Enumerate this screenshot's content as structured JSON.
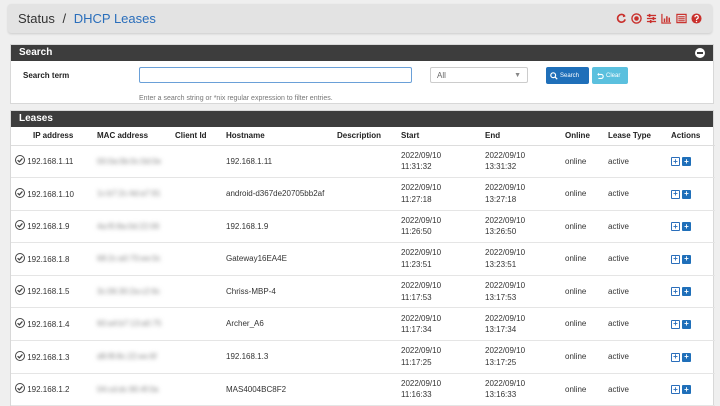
{
  "header": {
    "breadcrumb_root": "Status",
    "breadcrumb_sep": "/",
    "breadcrumb_page": "DHCP Leases",
    "icon_color": "#c9302c",
    "icons": [
      "reload-icon",
      "record-icon",
      "settings-sliders-icon",
      "chart-icon",
      "log-icon",
      "help-icon"
    ]
  },
  "search": {
    "title": "Search",
    "term_label": "Search term",
    "term_value": "",
    "filter_selected": "All",
    "search_button": "Search",
    "clear_button": "Clear",
    "help_text": "Enter a search string or *nix regular expression to filter entries."
  },
  "leases": {
    "title": "Leases",
    "columns": [
      "IP address",
      "MAC address",
      "Client Id",
      "Hostname",
      "Description",
      "Start",
      "End",
      "Online",
      "Lease Type",
      "Actions"
    ],
    "rows": [
      {
        "ip": "192.168.1.11",
        "mac": "00:0a:0b:0c:0d:0e",
        "client_id": "",
        "hostname": "192.168.1.11",
        "description": "",
        "start_date": "2022/09/10",
        "start_time": "11:31:32",
        "end_date": "2022/09/10",
        "end_time": "13:31:32",
        "online": "online",
        "lease_type": "active"
      },
      {
        "ip": "192.168.1.10",
        "mac": "1c:b7:2c:4d:a7:91",
        "client_id": "",
        "hostname": "android-d367de20705bb2af",
        "description": "",
        "start_date": "2022/09/10",
        "start_time": "11:27:18",
        "end_date": "2022/09/10",
        "end_time": "13:27:18",
        "online": "online",
        "lease_type": "active"
      },
      {
        "ip": "192.168.1.9",
        "mac": "4a:f0:8a:0d:22:06",
        "client_id": "",
        "hostname": "192.168.1.9",
        "description": "",
        "start_date": "2022/09/10",
        "start_time": "11:26:50",
        "end_date": "2022/09/10",
        "end_time": "13:26:50",
        "online": "online",
        "lease_type": "active"
      },
      {
        "ip": "192.168.1.8",
        "mac": "68:2c:a0:70:ee:0c",
        "client_id": "",
        "hostname": "Gateway16EA4E",
        "description": "",
        "start_date": "2022/09/10",
        "start_time": "11:23:51",
        "end_date": "2022/09/10",
        "end_time": "13:23:51",
        "online": "online",
        "lease_type": "active"
      },
      {
        "ip": "192.168.1.5",
        "mac": "3c:06:30:2a:c2:6c",
        "client_id": "",
        "hostname": "Chriss-MBP-4",
        "description": "",
        "start_date": "2022/09/10",
        "start_time": "11:17:53",
        "end_date": "2022/09/10",
        "end_time": "13:17:53",
        "online": "online",
        "lease_type": "active"
      },
      {
        "ip": "192.168.1.4",
        "mac": "60:a4:b7:13:a0:75",
        "client_id": "",
        "hostname": "Archer_A6",
        "description": "",
        "start_date": "2022/09/10",
        "start_time": "11:17:34",
        "end_date": "2022/09/10",
        "end_time": "13:17:34",
        "online": "online",
        "lease_type": "active"
      },
      {
        "ip": "192.168.1.3",
        "mac": "d8:f8:8c:22:ee:6f",
        "client_id": "",
        "hostname": "192.168.1.3",
        "description": "",
        "start_date": "2022/09/10",
        "start_time": "11:17:25",
        "end_date": "2022/09/10",
        "end_time": "13:17:25",
        "online": "online",
        "lease_type": "active"
      },
      {
        "ip": "192.168.1.2",
        "mac": "04:cd:dc:90:4f:0a",
        "client_id": "",
        "hostname": "MAS4004BC8F2",
        "description": "",
        "start_date": "2022/09/10",
        "start_time": "11:16:33",
        "end_date": "2022/09/10",
        "end_time": "13:16:33",
        "online": "online",
        "lease_type": "active"
      }
    ]
  }
}
